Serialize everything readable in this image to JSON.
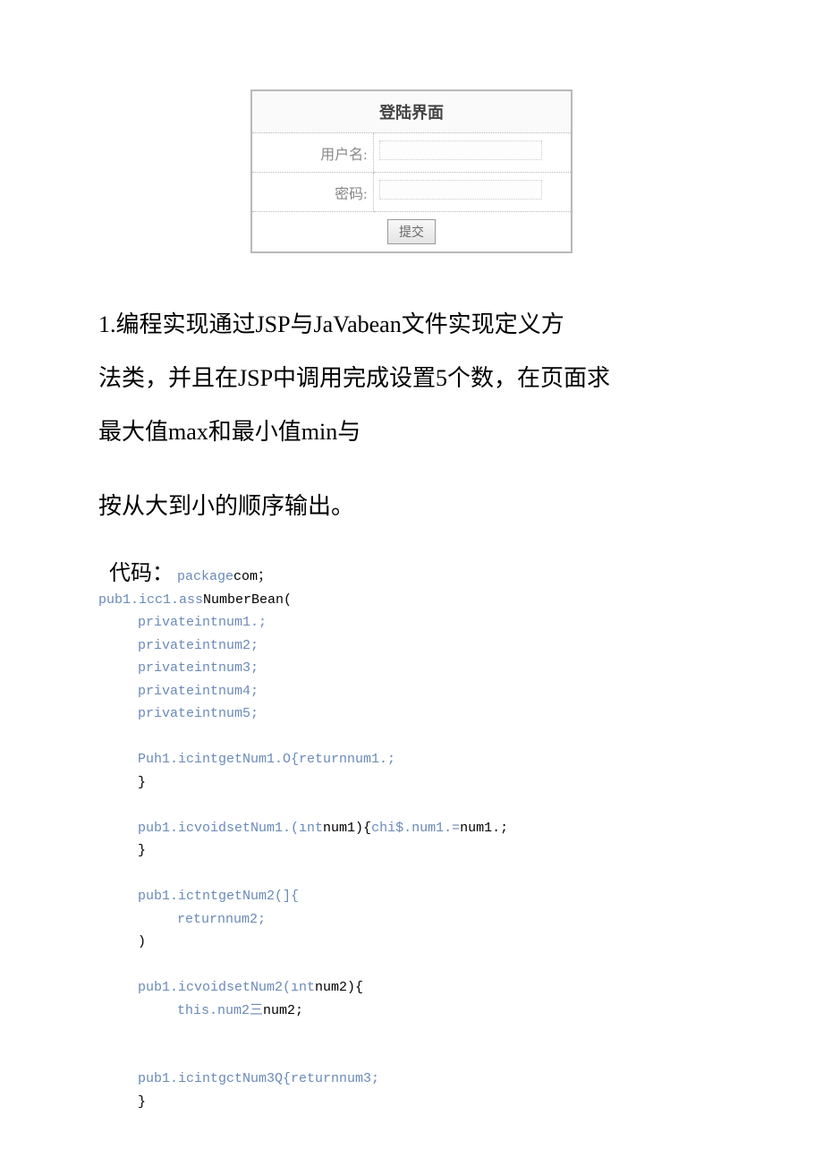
{
  "login": {
    "title": "登陆界面",
    "userLabel": "用户名:",
    "pwdLabel": "密码:",
    "submit": "提交"
  },
  "question": {
    "line1": "1.编程实现通过JSP与JaVabean文件实现定义方",
    "line2": "法类，并且在JSP中调用完成设置5个数，在页面求",
    "line3": "最大值max和最小值min与",
    "line4": "按从大到小的顺序输出。"
  },
  "codeLabel": "代码：",
  "code": {
    "pkg_kw": "package",
    "pkg_name": "com；",
    "class_pre": "pub1.icc1.ass",
    "class_name": "NumberBean(",
    "n1": "privateintnum1.;",
    "n2": "privateintnum2;",
    "n3": "privateintnum3;",
    "n4": "privateintnum4;",
    "n5": "privateintnum5;",
    "m1a": "Puh1.icintgetNum1.O{",
    "m1b": "returnnum1.;",
    "brace1": "}",
    "m2a_pre": "pub1.icvoidsetNum1.(ınt",
    "m2a_mid": "num1){",
    "m2a_suf": "chi$.num1.=",
    "m2a_end": "num1.;",
    "brace2": "}",
    "m3a": "pub1.ictntgetNum2(]{",
    "m3b": "returnnum2;",
    "brace3": ")",
    "m4a_pre": "pub1.icvoidsetNum2(ınt",
    "m4a_mid": "num2){",
    "m4b_pre": "this.num2三",
    "m4b_end": "num2;",
    "m5a": "pub1.icintgctNum3Q{",
    "m5b": "returnnum3;",
    "brace5": "}"
  }
}
